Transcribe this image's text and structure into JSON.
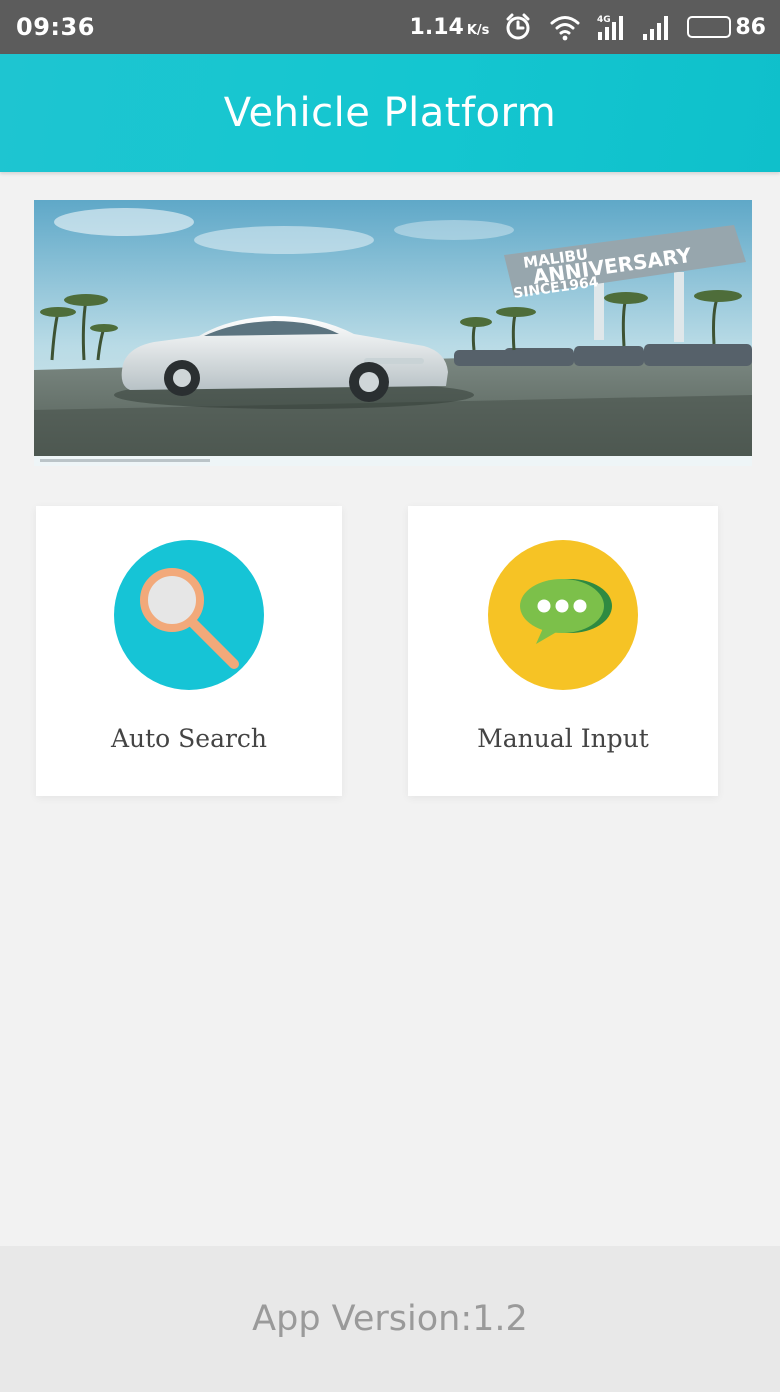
{
  "status_bar": {
    "time": "09:36",
    "net_speed": "1.14",
    "net_unit": "K/s",
    "battery_level": "86",
    "icons": [
      "alarm-icon",
      "wifi-icon",
      "4g-signal-icon",
      "signal-icon",
      "battery-icon"
    ]
  },
  "app_bar": {
    "title": "Vehicle Platform",
    "color": "#14c6d0"
  },
  "banner": {
    "billboard_line1": "MALIBU",
    "billboard_line2": "ANNIVERSARY",
    "billboard_line3": "SINCE1964"
  },
  "actions": [
    {
      "label": "Auto Search",
      "icon": "magnifier-icon",
      "color": "#16c4d6"
    },
    {
      "label": "Manual Input",
      "icon": "chat-bubble-icon",
      "color": "#f6c325"
    }
  ],
  "footer": {
    "version_text": "App Version:1.2"
  }
}
